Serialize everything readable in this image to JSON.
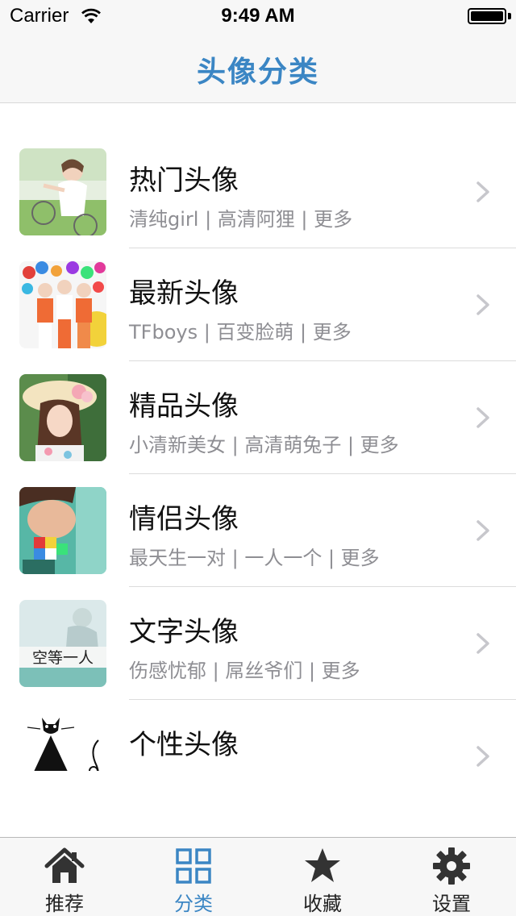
{
  "status_bar": {
    "carrier": "Carrier",
    "time": "9:49 AM"
  },
  "nav": {
    "title": "头像分类"
  },
  "categories": [
    {
      "title": "热门头像",
      "subtitle": "清纯girl | 高清阿狸 | 更多"
    },
    {
      "title": "最新头像",
      "subtitle": "TFboys | 百变脸萌 | 更多"
    },
    {
      "title": "精品头像",
      "subtitle": "小清新美女 | 高清萌兔子 | 更多"
    },
    {
      "title": "情侣头像",
      "subtitle": "最天生一对 | 一人一个 | 更多"
    },
    {
      "title": "文字头像",
      "subtitle": "伤感忧郁 | 屌丝爷们 | 更多",
      "thumb_text": "空等一人"
    },
    {
      "title": "个性头像",
      "subtitle": ""
    }
  ],
  "tabs": [
    {
      "label": "推荐",
      "icon": "home-icon"
    },
    {
      "label": "分类",
      "icon": "grid-icon",
      "active": true
    },
    {
      "label": "收藏",
      "icon": "star-icon"
    },
    {
      "label": "设置",
      "icon": "gear-icon"
    }
  ],
  "colors": {
    "accent": "#3b86c4",
    "subtitle": "#8e8e93",
    "bar_bg": "#f7f7f7"
  }
}
